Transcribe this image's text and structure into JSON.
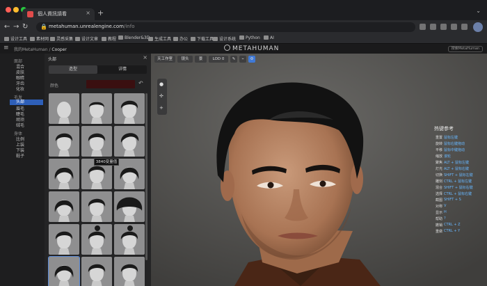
{
  "browser": {
    "tab": {
      "title": "個人資訊請看"
    },
    "url": {
      "host": "metahuman.unrealengine.com",
      "path": "/info"
    },
    "bookmarks": [
      "设计工具",
      "素材网",
      "灵感采集",
      "设计文章",
      "教程",
      "Blender&3D",
      "生成工具",
      "办公",
      "下载工具",
      "设计系统",
      "Python",
      "AI"
    ]
  },
  "app": {
    "breadcrumb": {
      "parent": "我的MetaHuman",
      "current": "Cooper"
    },
    "logo": "METAHUMAN",
    "search_placeholder": "搜索MetaHuman"
  },
  "nav": [
    {
      "label": "面部",
      "type": "header"
    },
    {
      "label": "混合",
      "type": "sub"
    },
    {
      "label": "皮肤",
      "type": "sub"
    },
    {
      "label": "眼睛",
      "type": "sub"
    },
    {
      "label": "牙齿",
      "type": "sub"
    },
    {
      "label": "化妆",
      "type": "sub"
    },
    {
      "label": "毛发",
      "type": "header"
    },
    {
      "label": "头部",
      "type": "active"
    },
    {
      "label": "眉毛",
      "type": "sub"
    },
    {
      "label": "睫毛",
      "type": "sub"
    },
    {
      "label": "胡须",
      "type": "sub"
    },
    {
      "label": "绒毛",
      "type": "sub"
    },
    {
      "label": "身体",
      "type": "header"
    },
    {
      "label": "比例",
      "type": "sub"
    },
    {
      "label": "上装",
      "type": "sub"
    },
    {
      "label": "下装",
      "type": "sub"
    },
    {
      "label": "鞋子",
      "type": "sub"
    }
  ],
  "panel": {
    "title": "头部",
    "tabs": [
      {
        "label": "造型",
        "active": true
      },
      {
        "label": "详情",
        "active": false
      }
    ],
    "color_label": "颜色",
    "swatch_color": "#3a0f10",
    "tooltip": "3840变量值",
    "thumbnails": [
      {
        "hair": "bald"
      },
      {
        "hair": "buzz"
      },
      {
        "hair": "short"
      },
      {
        "hair": "short"
      },
      {
        "hair": "short"
      },
      {
        "hair": "slick"
      },
      {
        "hair": "mid"
      },
      {
        "hair": "bun"
      },
      {
        "hair": "mid"
      },
      {
        "hair": "mid"
      },
      {
        "hair": "short"
      },
      {
        "hair": "afro"
      },
      {
        "hair": "short"
      },
      {
        "hair": "bun"
      },
      {
        "hair": "bun"
      },
      {
        "hair": "mid"
      },
      {
        "hair": "short"
      },
      {
        "hair": "short"
      }
    ]
  },
  "viewport": {
    "toolbar": [
      "天工作室",
      "镜头",
      "景",
      "LOD 0"
    ],
    "side_icons": [
      "light-icon",
      "move-icon",
      "plus-icon"
    ]
  },
  "overlay": {
    "title": "热键参考",
    "rows": [
      {
        "k": "重置",
        "v": "鼠标左键"
      },
      {
        "k": "旋转",
        "v": "鼠标右键拖动"
      },
      {
        "k": "平移",
        "v": "鼠标中键拖动"
      },
      {
        "k": "缩放",
        "v": "滚轮"
      },
      {
        "k": "聚焦",
        "v": "ALT + 鼠标左键"
      },
      {
        "k": "灯光",
        "v": "ALT + 鼠标右键"
      },
      {
        "k": "切换",
        "v": "SHIFT + 鼠标左键"
      },
      {
        "k": "雕刻",
        "v": "CTRL + 鼠标左键"
      },
      {
        "k": "混合",
        "v": "SHIFT + 鼠标右键"
      },
      {
        "k": "选择",
        "v": "CTRL + 鼠标右键"
      },
      {
        "k": "截图",
        "v": "SHIFT + S"
      },
      {
        "k": "对称",
        "v": "V"
      },
      {
        "k": "显示",
        "v": "H"
      },
      {
        "k": "帮助",
        "v": "?"
      },
      {
        "k": "撤销",
        "v": "CTRL + Z"
      },
      {
        "k": "重做",
        "v": "CTRL + Y"
      }
    ]
  }
}
